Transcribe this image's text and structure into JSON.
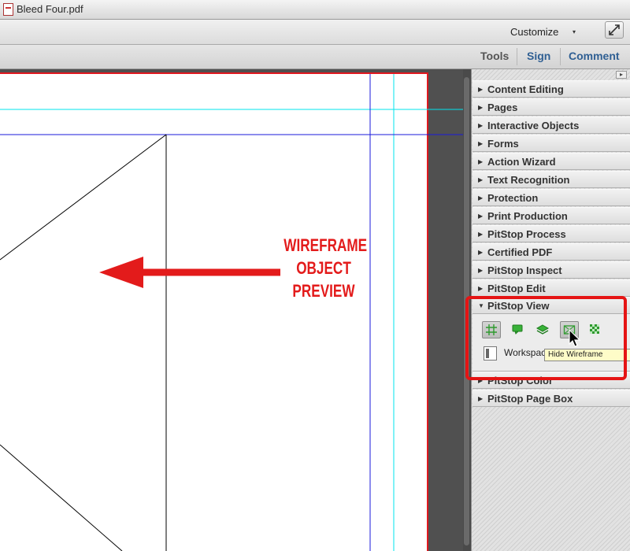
{
  "window": {
    "title": "Bleed Four.pdf"
  },
  "toolbar": {
    "customize_label": "Customize",
    "customize_caret": "▾"
  },
  "tabs": [
    {
      "label": "Tools"
    },
    {
      "label": "Sign"
    },
    {
      "label": "Comment"
    }
  ],
  "panel": {
    "menu_glyph": "▸",
    "sections_before": [
      {
        "label": "Content Editing"
      },
      {
        "label": "Pages"
      },
      {
        "label": "Interactive Objects"
      },
      {
        "label": "Forms"
      },
      {
        "label": "Action Wizard"
      },
      {
        "label": "Text Recognition"
      },
      {
        "label": "Protection"
      },
      {
        "label": "Print Production"
      },
      {
        "label": "PitStop Process"
      },
      {
        "label": "Certified PDF"
      },
      {
        "label": "PitStop Inspect"
      },
      {
        "label": "PitStop Edit"
      }
    ],
    "expanded_section": {
      "label": "PitStop View",
      "tools": [
        {
          "icon": "grid-icon",
          "active": true
        },
        {
          "icon": "comment-icon",
          "active": false
        },
        {
          "icon": "layers-icon",
          "active": false
        },
        {
          "icon": "wireframe-icon",
          "active": true
        },
        {
          "icon": "checker-icon",
          "active": false
        }
      ],
      "workspaces_label": "Workspaces",
      "tooltip": "Hide Wireframe"
    },
    "sections_after": [
      {
        "label": "PitStop Color"
      },
      {
        "label": "PitStop Page Box"
      }
    ]
  },
  "callout": {
    "lines": [
      "WIREFRAME",
      "OBJECT",
      "PREVIEW"
    ]
  },
  "colors": {
    "annotation_red": "#e31b1b",
    "guide_cyan": "#00e5ee",
    "guide_blue": "#1a1adb",
    "link_blue": "#2f5f93"
  }
}
